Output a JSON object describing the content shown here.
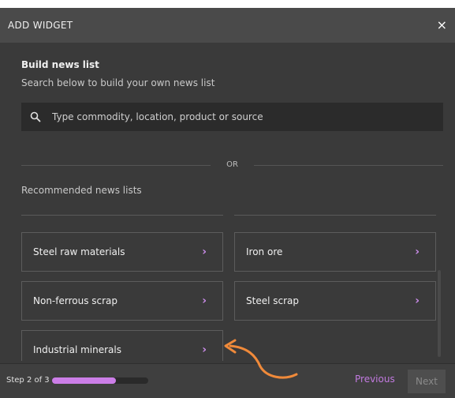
{
  "header": {
    "title": "ADD WIDGET",
    "close_glyph": "×"
  },
  "build": {
    "title": "Build news list",
    "subtitle": "Search below to build your own news list",
    "search_placeholder": "Type commodity, location, product or source"
  },
  "divider": {
    "text": "OR"
  },
  "recommended": {
    "title": "Recommended news lists",
    "items": [
      {
        "label": "Steel raw materials",
        "icon": "chevron-right-icon"
      },
      {
        "label": "Iron ore",
        "icon": "chevron-right-icon"
      },
      {
        "label": "Non-ferrous scrap",
        "icon": "chevron-right-icon"
      },
      {
        "label": "Steel scrap",
        "icon": "chevron-right-icon"
      },
      {
        "label": "Industrial minerals",
        "icon": "chevron-right-icon"
      }
    ],
    "chevron_glyph": "›"
  },
  "footer": {
    "step_text": "Step 2 of 3",
    "progress_fraction": 0.667,
    "previous_label": "Previous",
    "next_label": "Next"
  },
  "colors": {
    "accent": "#cc7ee8",
    "background": "#3a3a3a",
    "header": "#4a4a4a",
    "annotation": "#f08a3a"
  }
}
